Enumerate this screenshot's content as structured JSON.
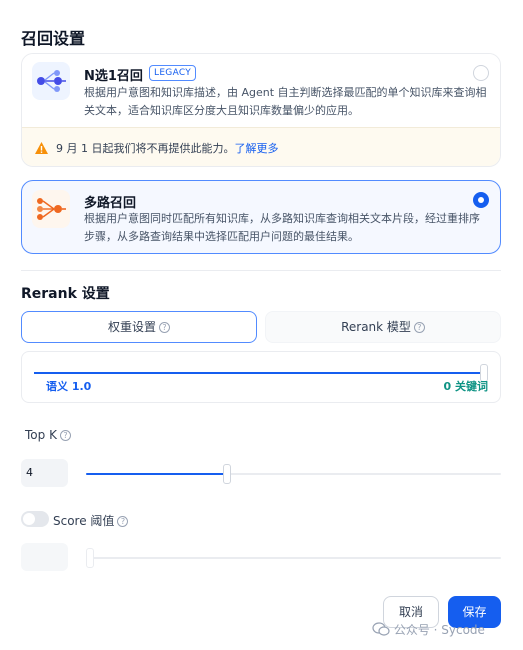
{
  "retrieval": {
    "title": "召回设置",
    "legacy_option": {
      "title": "N选1召回",
      "badge": "LEGACY",
      "description": "根据用户意图和知识库描述，由 Agent 自主判断选择最匹配的单个知识库来查询相关文本，适合知识库区分度大且知识库数量偏少的应用。",
      "warning_text": "9 月 1 日起我们将不再提供此能力。",
      "warning_link": "了解更多"
    },
    "multi_option": {
      "title": "多路召回",
      "description": "根据用户意图同时匹配所有知识库，从多路知识库查询相关文本片段，经过重排序步骤，从多路查询结果中选择匹配用户问题的最佳结果。",
      "selected": true
    }
  },
  "rerank": {
    "title": "Rerank 设置",
    "tabs": [
      {
        "label": "权重设置",
        "active": true
      },
      {
        "label": "Rerank 模型",
        "active": false
      }
    ],
    "weight": {
      "left_label": "语义 1.0",
      "right_label": "0 关键词",
      "semantic_value": 1.0
    }
  },
  "top_k": {
    "label": "Top K",
    "value": "4",
    "slider_fraction": 0.34
  },
  "score": {
    "label": "Score 阈值",
    "enabled": false,
    "slider_fraction": 0.0
  },
  "footer": {
    "cancel_label": "取消",
    "save_label": "保存"
  },
  "watermark": {
    "text": "公众号 · Sycode"
  },
  "colors": {
    "primary": "#155eef",
    "accent_teal": "#0e9384",
    "warning": "#f79009",
    "icon_orange": "#ef6820"
  }
}
